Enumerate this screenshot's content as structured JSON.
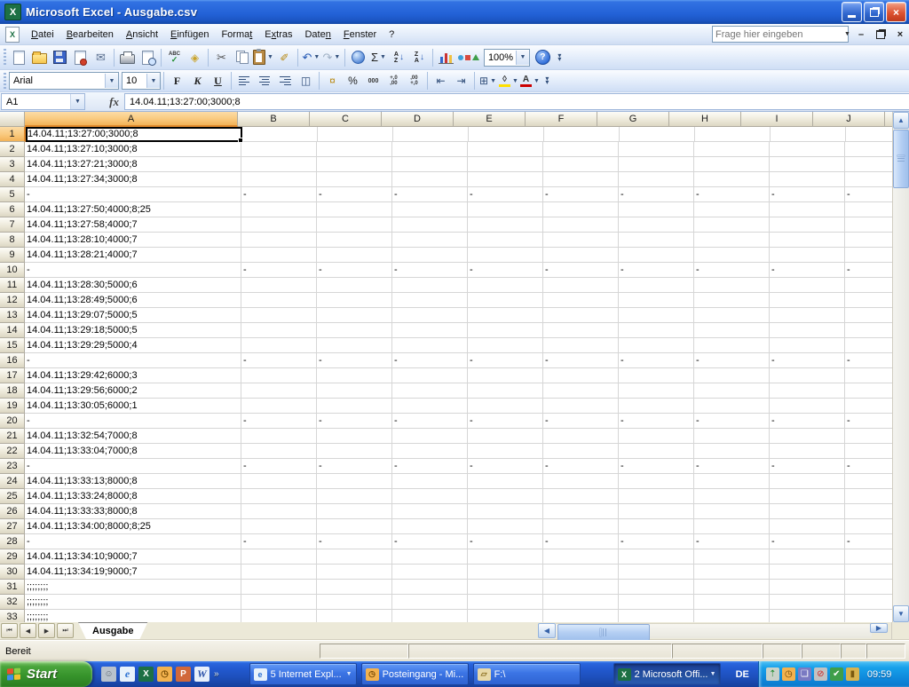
{
  "window": {
    "title": "Microsoft Excel - Ausgabe.csv",
    "app_icon_letter": "X",
    "doc_icon_letter": "X"
  },
  "menu": {
    "items": [
      {
        "label": "Datei",
        "u": 0
      },
      {
        "label": "Bearbeiten",
        "u": 0
      },
      {
        "label": "Ansicht",
        "u": 0
      },
      {
        "label": "Einfügen",
        "u": 0
      },
      {
        "label": "Format",
        "u": 5
      },
      {
        "label": "Extras",
        "u": 1
      },
      {
        "label": "Daten",
        "u": 4
      },
      {
        "label": "Fenster",
        "u": 0
      },
      {
        "label": "?",
        "u": -1
      }
    ],
    "question_placeholder": "Frage hier eingeben"
  },
  "toolbar_standard": [
    {
      "name": "new-document-icon",
      "kind": "page"
    },
    {
      "name": "open-icon",
      "kind": "folder"
    },
    {
      "name": "save-icon",
      "kind": "floppy"
    },
    {
      "name": "permission-icon",
      "kind": "page",
      "dot": true
    },
    {
      "name": "email-icon",
      "kind": "glyph",
      "glyph": "✉",
      "color": "#5b708f",
      "size": 13,
      "sep": true
    },
    {
      "name": "print-icon",
      "kind": "printer"
    },
    {
      "name": "print-preview-icon",
      "kind": "pagemag",
      "sep": true
    },
    {
      "name": "spelling-icon",
      "kind": "abc",
      "text": "ABC",
      "check": "✓"
    },
    {
      "name": "research-icon",
      "kind": "glyph",
      "glyph": "◈",
      "color": "#c9a227",
      "size": 12,
      "sep": true
    },
    {
      "name": "cut-icon",
      "kind": "glyph",
      "glyph": "✂",
      "color": "#555",
      "size": 13
    },
    {
      "name": "copy-icon",
      "kind": "copy2"
    },
    {
      "name": "paste-icon",
      "kind": "clipboard",
      "dd": true
    },
    {
      "name": "format-painter-icon",
      "kind": "glyph",
      "glyph": "✐",
      "color": "#b8860b",
      "size": 12,
      "sep": true
    },
    {
      "name": "undo-icon",
      "kind": "glyph",
      "glyph": "↶",
      "color": "#2458b3",
      "size": 13,
      "dd": true
    },
    {
      "name": "redo-icon",
      "kind": "glyph",
      "glyph": "↷",
      "color": "#9fb0c4",
      "size": 13,
      "dd": true,
      "sep": true
    },
    {
      "name": "insert-hyperlink-icon",
      "kind": "globe"
    },
    {
      "name": "autosum-icon",
      "kind": "glyph",
      "glyph": "Σ",
      "color": "#222",
      "size": 13,
      "dd": true
    },
    {
      "name": "sort-ascending-icon",
      "kind": "sort",
      "top": "A",
      "bottom": "Z",
      "arrow": "↓"
    },
    {
      "name": "sort-descending-icon",
      "kind": "sort",
      "top": "Z",
      "bottom": "A",
      "arrow": "↓",
      "sep": true
    },
    {
      "name": "chart-wizard-icon",
      "kind": "bars",
      "colors": [
        "#3366cc",
        "#cc3333",
        "#f0c040"
      ],
      "heights": [
        7,
        11,
        9
      ]
    },
    {
      "name": "drawing-icon",
      "kind": "draw"
    },
    {
      "name": "zoom-select",
      "kind": "zoombox",
      "value": "100%"
    },
    {
      "name": "help-icon",
      "kind": "help",
      "glyph": "?"
    }
  ],
  "toolbar_formatting": {
    "font_name": "Arial",
    "font_size": "10",
    "icons": [
      {
        "name": "bold-button",
        "kind": "letter",
        "glyph": "F",
        "style": "bold"
      },
      {
        "name": "italic-button",
        "kind": "letter",
        "glyph": "K",
        "style": "italic"
      },
      {
        "name": "underline-button",
        "kind": "letter",
        "glyph": "U",
        "style": "underline",
        "sep": true
      },
      {
        "name": "align-left-icon",
        "kind": "align",
        "a": "left"
      },
      {
        "name": "align-center-icon",
        "kind": "align",
        "a": "center"
      },
      {
        "name": "align-right-icon",
        "kind": "align",
        "a": "right"
      },
      {
        "name": "merge-center-icon",
        "kind": "glyph",
        "glyph": "◫",
        "color": "#33507c",
        "size": 12,
        "sep": true
      },
      {
        "name": "currency-icon",
        "kind": "glyph",
        "glyph": "¤",
        "color": "#b8860b",
        "size": 12
      },
      {
        "name": "percent-icon",
        "kind": "glyph",
        "glyph": "%",
        "color": "#222",
        "size": 12
      },
      {
        "name": "thousands-separator-icon",
        "kind": "txt",
        "text": "000"
      },
      {
        "name": "increase-decimal-icon",
        "kind": "txt2",
        "top": "+,0",
        "bottom": ",00"
      },
      {
        "name": "decrease-decimal-icon",
        "kind": "txt2",
        "top": ",00",
        "bottom": "+,0",
        "sep": true
      },
      {
        "name": "decrease-indent-icon",
        "kind": "glyph",
        "glyph": "⇤",
        "color": "#33507c",
        "size": 12
      },
      {
        "name": "increase-indent-icon",
        "kind": "glyph",
        "glyph": "⇥",
        "color": "#33507c",
        "size": 12,
        "sep": true
      },
      {
        "name": "borders-icon",
        "kind": "glyph",
        "glyph": "⊞",
        "color": "#33507c",
        "size": 12,
        "dd": true
      },
      {
        "name": "fill-color-icon",
        "kind": "cbar",
        "glyph": "◊",
        "bar": "#ffe000",
        "dd": true
      },
      {
        "name": "font-color-icon",
        "kind": "cbar",
        "glyph": "A",
        "bar": "#cc0000",
        "dd": true
      }
    ]
  },
  "formula_bar": {
    "name_box": "A1",
    "fx_label": "fx",
    "value": "14.04.11;13:27:00;3000;8"
  },
  "grid": {
    "columns": [
      "A",
      "B",
      "C",
      "D",
      "E",
      "F",
      "G",
      "H",
      "I",
      "J"
    ],
    "dash": "-",
    "semis": ";;;;;;;;",
    "rows": [
      {
        "n": 1,
        "type": "data",
        "a": "14.04.11;13:27:00;3000;8",
        "selected": true
      },
      {
        "n": 2,
        "type": "data",
        "a": "14.04.11;13:27:10;3000;8"
      },
      {
        "n": 3,
        "type": "data",
        "a": "14.04.11;13:27:21;3000;8"
      },
      {
        "n": 4,
        "type": "data",
        "a": "14.04.11;13:27:34;3000;8"
      },
      {
        "n": 5,
        "type": "dash"
      },
      {
        "n": 6,
        "type": "data",
        "a": "14.04.11;13:27:50;4000;8;25"
      },
      {
        "n": 7,
        "type": "data",
        "a": "14.04.11;13:27:58;4000;7"
      },
      {
        "n": 8,
        "type": "data",
        "a": "14.04.11;13:28:10;4000;7"
      },
      {
        "n": 9,
        "type": "data",
        "a": "14.04.11;13:28:21;4000;7"
      },
      {
        "n": 10,
        "type": "dash"
      },
      {
        "n": 11,
        "type": "data",
        "a": "14.04.11;13:28:30;5000;6"
      },
      {
        "n": 12,
        "type": "data",
        "a": "14.04.11;13:28:49;5000;6"
      },
      {
        "n": 13,
        "type": "data",
        "a": "14.04.11;13:29:07;5000;5"
      },
      {
        "n": 14,
        "type": "data",
        "a": "14.04.11;13:29:18;5000;5"
      },
      {
        "n": 15,
        "type": "data",
        "a": "14.04.11;13:29:29;5000;4"
      },
      {
        "n": 16,
        "type": "dash"
      },
      {
        "n": 17,
        "type": "data",
        "a": "14.04.11;13:29:42;6000;3"
      },
      {
        "n": 18,
        "type": "data",
        "a": "14.04.11;13:29:56;6000;2"
      },
      {
        "n": 19,
        "type": "data",
        "a": "14.04.11;13:30:05;6000;1"
      },
      {
        "n": 20,
        "type": "dash"
      },
      {
        "n": 21,
        "type": "data",
        "a": "14.04.11;13:32:54;7000;8"
      },
      {
        "n": 22,
        "type": "data",
        "a": "14.04.11;13:33:04;7000;8"
      },
      {
        "n": 23,
        "type": "dash"
      },
      {
        "n": 24,
        "type": "data",
        "a": "14.04.11;13:33:13;8000;8"
      },
      {
        "n": 25,
        "type": "data",
        "a": "14.04.11;13:33:24;8000;8"
      },
      {
        "n": 26,
        "type": "data",
        "a": "14.04.11;13:33:33;8000;8"
      },
      {
        "n": 27,
        "type": "data",
        "a": "14.04.11;13:34:00;8000;8;25"
      },
      {
        "n": 28,
        "type": "dash"
      },
      {
        "n": 29,
        "type": "data",
        "a": "14.04.11;13:34:10;9000;7"
      },
      {
        "n": 30,
        "type": "data",
        "a": "14.04.11;13:34:19;9000;7"
      },
      {
        "n": 31,
        "type": "semi"
      },
      {
        "n": 32,
        "type": "semi"
      },
      {
        "n": 33,
        "type": "semi"
      }
    ]
  },
  "sheet_tabs": {
    "active_tab": "Ausgabe",
    "nav": [
      "⏮",
      "◀",
      "▶",
      "⏭"
    ]
  },
  "status_bar": {
    "text": "Bereit"
  },
  "taskbar": {
    "start_label": "Start",
    "quick_launch": [
      {
        "name": "messenger-icon",
        "bg": "#b9c2cc",
        "glyph": "☺",
        "fg": "#5b6570"
      },
      {
        "name": "internet-explorer-icon",
        "bg": "#e8f2fb",
        "glyph": "e",
        "fg": "#2a6fd1"
      },
      {
        "name": "excel-icon",
        "bg": "#1d7044",
        "glyph": "X",
        "fg": "#ffffff"
      },
      {
        "name": "outlook-icon",
        "bg": "#f3b24e",
        "glyph": "◷",
        "fg": "#7a4d06"
      },
      {
        "name": "powerpoint-icon",
        "bg": "#d1683a",
        "glyph": "P",
        "fg": "#ffffff"
      },
      {
        "name": "word-icon",
        "bg": "#e8f0fb",
        "glyph": "W",
        "fg": "#2a50a8"
      }
    ],
    "quick_launch_chevron": "»",
    "buttons": [
      {
        "name": "taskbar-button-internet-explorer",
        "label": "5 Internet Expl...",
        "icon_bg": "#e8f2fb",
        "icon_glyph": "e",
        "icon_fg": "#2a6fd1",
        "dropdown": true,
        "active": false
      },
      {
        "name": "taskbar-button-outlook",
        "label": "Posteingang - Mi...",
        "icon_bg": "#f3b24e",
        "icon_glyph": "◷",
        "icon_fg": "#7a4d06",
        "dropdown": false,
        "active": false
      },
      {
        "name": "taskbar-button-explorer",
        "label": "F:\\",
        "icon_bg": "#e9d9a8",
        "icon_glyph": "▱",
        "icon_fg": "#8a6d1e",
        "dropdown": false,
        "active": false
      },
      {
        "name": "taskbar-button-excel-group",
        "label": "2 Microsoft Offi...",
        "icon_bg": "#1d7044",
        "icon_glyph": "X",
        "icon_fg": "#ffffff",
        "dropdown": true,
        "active": true
      }
    ],
    "language_indicator": "DE",
    "tray_icons": [
      {
        "name": "safely-remove-hardware-icon",
        "bg": "#c9d2c9",
        "glyph": "⇡",
        "fg": "#1e8c2e"
      },
      {
        "name": "reminder-clock-icon",
        "bg": "#f3b24e",
        "glyph": "◷",
        "fg": "#6b4206"
      },
      {
        "name": "network-icon",
        "bg": "#7a7ac2",
        "glyph": "❏",
        "fg": "#ffffff"
      },
      {
        "name": "volume-muted-icon",
        "bg": "#c2c2c2",
        "glyph": "⊘",
        "fg": "#c22"
      },
      {
        "name": "antivirus-icon",
        "bg": "#3f9e4a",
        "glyph": "✔",
        "fg": "#ffffff"
      },
      {
        "name": "update-shield-icon",
        "bg": "#d8b34e",
        "glyph": "▮",
        "fg": "#7a5a10"
      }
    ],
    "clock": "09:59"
  }
}
